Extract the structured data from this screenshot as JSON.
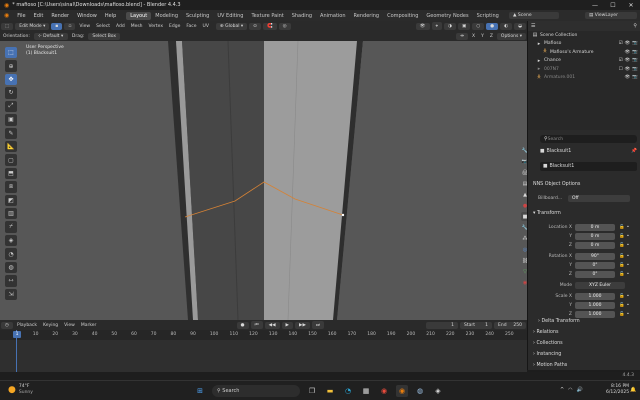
{
  "window": {
    "title": "* mafioso [C:\\Users\\sinal\\Downloads\\mafioso.blend] - Blender 4.4.3",
    "controls": [
      "—",
      "☐",
      "✕"
    ]
  },
  "menubar": {
    "items": [
      "File",
      "Edit",
      "Render",
      "Window",
      "Help"
    ],
    "workspaces": [
      "Layout",
      "Modeling",
      "Sculpting",
      "UV Editing",
      "Texture Paint",
      "Shading",
      "Animation",
      "Rendering",
      "Compositing",
      "Geometry Nodes",
      "Scripting"
    ],
    "active_workspace": "Layout",
    "scene": "Scene",
    "view_layer": "ViewLayer"
  },
  "viewport_header": {
    "mode": "Edit Mode",
    "menus": [
      "View",
      "Select",
      "Add",
      "Mesh",
      "Vertex",
      "Edge",
      "Face",
      "UV"
    ],
    "transform_orientation": "Global",
    "axes": [
      "X",
      "Y",
      "Z"
    ],
    "options": "Options"
  },
  "viewport_header2": {
    "orientation_label": "Orientation:",
    "orientation_value": "Default",
    "drag_label": "Drag:",
    "drag_value": "Select Box"
  },
  "viewport": {
    "info_line1": "User Perspective",
    "info_line2": "(1) Blacksuit1",
    "accent": "#4772b3",
    "edge_color": "#d58235"
  },
  "outliner": {
    "rows": [
      {
        "label": "Scene Collection",
        "icon": "collection-icon",
        "indent": 0
      },
      {
        "label": "Mafioso",
        "icon": "collection-icon",
        "indent": 1
      },
      {
        "label": "Mafioso's Armature",
        "icon": "armature-icon",
        "indent": 2
      },
      {
        "label": "Chance",
        "icon": "collection-icon",
        "indent": 1
      },
      {
        "label": "007N7",
        "icon": "collection-icon",
        "indent": 1
      },
      {
        "label": "Armature.001",
        "icon": "armature-icon",
        "indent": 1
      }
    ]
  },
  "properties": {
    "search_placeholder": "Search",
    "object_name": "Blacksuit1",
    "object_name2": "Blacksuit1",
    "nns_options": "NNS Object Options",
    "billboard_label": "Billboard...",
    "billboard_value": "Off",
    "transform_title": "Transform",
    "location_label": "Location X",
    "location": [
      "0 m",
      "0 m",
      "0 m"
    ],
    "rotation_label": "Rotation X",
    "rotation": [
      "90°",
      "0°",
      "0°"
    ],
    "mode_label": "Mode",
    "mode_value": "XYZ Euler",
    "scale_label": "Scale X",
    "scale": [
      "1.000",
      "1.000",
      "1.000"
    ],
    "axis_y": "Y",
    "axis_z": "Z",
    "panels": [
      "Delta Transform",
      "Relations",
      "Collections",
      "Instancing",
      "Motion Paths"
    ]
  },
  "timeline": {
    "menus": [
      "Playback",
      "Keying",
      "View",
      "Marker"
    ],
    "current_frame": "1",
    "start_label": "Start",
    "start": "1",
    "end_label": "End",
    "end": "250",
    "ticks": [
      "1",
      "10",
      "20",
      "30",
      "40",
      "50",
      "60",
      "70",
      "80",
      "90",
      "100",
      "110",
      "120",
      "130",
      "140",
      "150",
      "160",
      "170",
      "180",
      "190",
      "200",
      "210",
      "220",
      "230",
      "240",
      "250"
    ]
  },
  "statusbar": {
    "version": "4.4.3"
  },
  "taskbar": {
    "weather_temp": "74°F",
    "weather_desc": "Sunny",
    "search_placeholder": "Search",
    "time": "8:16 PM",
    "date": "6/12/2025"
  }
}
